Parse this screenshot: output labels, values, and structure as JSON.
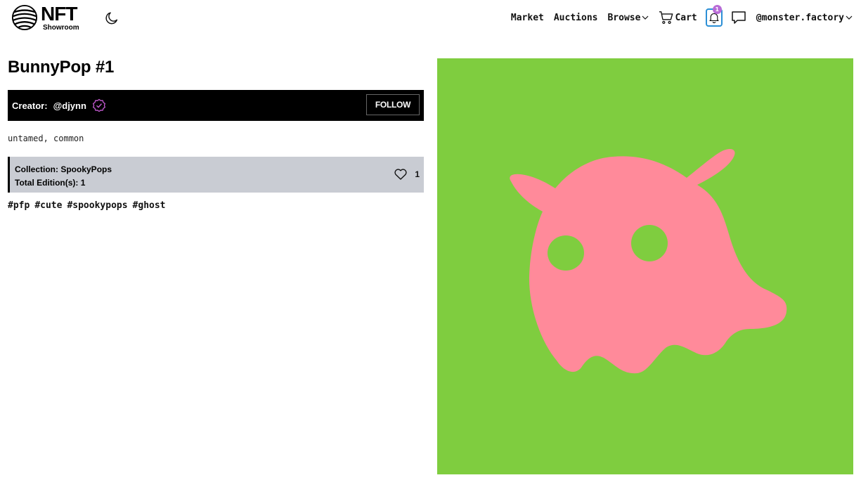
{
  "header": {
    "logo": {
      "title": "NFT",
      "subtitle": "Showroom"
    },
    "nav": {
      "market": "Market",
      "auctions": "Auctions",
      "browse": "Browse",
      "cart": "Cart",
      "notification_count": "1",
      "username": "@monster.factory"
    }
  },
  "item": {
    "title": "BunnyPop #1",
    "creator_label": "Creator:",
    "creator_handle": "@djynn",
    "follow_label": "FOLLOW",
    "traits": "untamed, common",
    "collection_label": "Collection:",
    "collection_name": "SpookyPops",
    "editions_label": "Total Edition(s):",
    "editions_value": "1",
    "likes": "1",
    "tags": [
      "#pfp",
      "#cute",
      "#spookypops",
      "#ghost"
    ]
  },
  "colors": {
    "artwork_background": "#7fcd3f",
    "ghost": "#ff8a9a",
    "verified": "#c45bd1",
    "notification_border": "#2b8fd6",
    "collection_background": "#c9ccd3"
  },
  "icons": [
    "logo-globe-icon",
    "moon-icon",
    "chevron-down-icon",
    "cart-icon",
    "bell-icon",
    "chat-icon",
    "verified-icon",
    "heart-icon"
  ]
}
